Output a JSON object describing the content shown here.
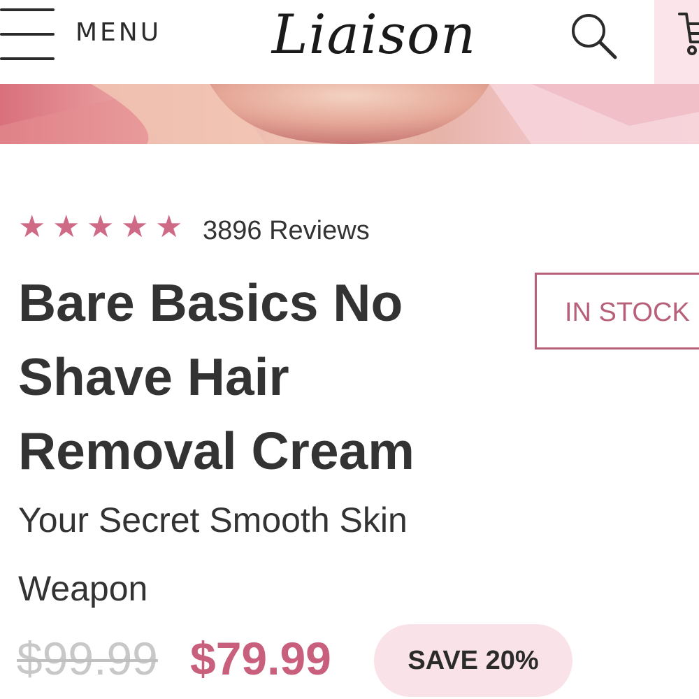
{
  "header": {
    "menu_label": "MENU",
    "logo_text": "Liaison",
    "search_icon": "search-icon",
    "cart_icon": "cart-icon",
    "cart_bg_color": "#fbe4ea"
  },
  "product": {
    "rating": {
      "stars": 5,
      "max_stars": 5,
      "star_glyph": "★",
      "star_color": "#cf6a86",
      "reviews_text": "3896 Reviews"
    },
    "title": "Bare Basics No Shave Hair Removal Cream",
    "subtitle": "Your Secret Smooth Skin Weapon",
    "stock_status": "IN STOCK",
    "price": {
      "original": "$99.99",
      "sale": "$79.99",
      "discount_label": "SAVE 20%"
    }
  },
  "colors": {
    "accent": "#c8607d",
    "text": "#333333",
    "strikethrough_price": "#c8c8c8",
    "badge_background": "#f9e2e8"
  }
}
